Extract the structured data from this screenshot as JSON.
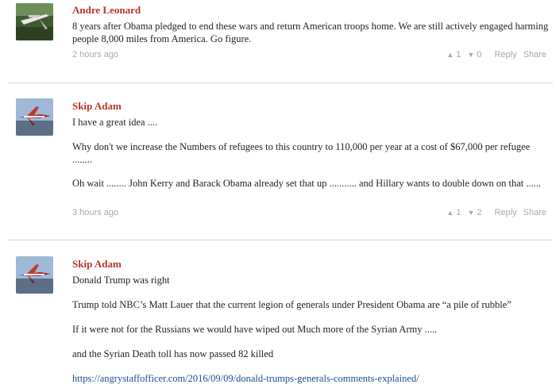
{
  "comments": [
    {
      "author": "Andre Leonard",
      "paragraphs": [
        "8 years after Obama pledged to end these wars and return American troops home. We are still actively engaged harming people 8,000 miles from America. Go figure."
      ],
      "timestamp": "2 hours ago",
      "upvotes": "1",
      "downvotes": "0",
      "reply_label": "Reply",
      "share_label": "Share"
    },
    {
      "author": "Skip Adam",
      "paragraphs": [
        "I have a great idea ....",
        "Why don't we increase the Numbers of refugees to this country to 110,000 per year at a cost of $67,000 per refugee ........",
        "Oh wait ........ John Kerry and Barack Obama already set that up ........... and Hillary wants to double down on that ......"
      ],
      "timestamp": "3 hours ago",
      "upvotes": "1",
      "downvotes": "2",
      "reply_label": "Reply",
      "share_label": "Share"
    },
    {
      "author": "Skip Adam",
      "paragraphs": [
        "Donald Trump was right",
        "Trump told NBC’s Matt Lauer that the current legion of generals under President Obama are “a pile of rubble”",
        "If it were not for the Russians we would have wiped out Much more of the Syrian Army .....",
        "and the Syrian Death toll has now passed 82 killed"
      ],
      "link": "https://angrystaffofficer.com/2016/09/09/donald-trumps-generals-comments-explained/"
    }
  ],
  "icons": {
    "upvote": "up-arrow-icon",
    "downvote": "down-arrow-icon"
  },
  "colors": {
    "author": "#b6372a",
    "meta": "#a8a8a8",
    "link": "#1a4f8f",
    "divider": "#d6d6d6"
  }
}
